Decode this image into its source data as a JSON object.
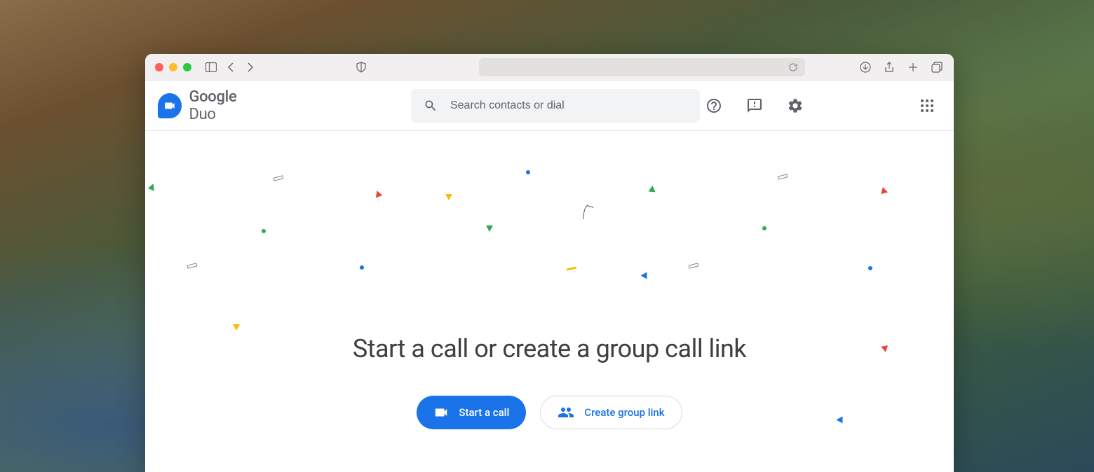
{
  "app": {
    "name_bold": "Google",
    "name_light": "Duo"
  },
  "search": {
    "placeholder": "Search contacts or dial"
  },
  "main": {
    "headline": "Start a call or create a group call link",
    "start_call_label": "Start a call",
    "create_group_label": "Create group link"
  },
  "colors": {
    "blue": "#1a73e8",
    "red": "#ea4335",
    "yellow": "#fbbc04",
    "green": "#34a853",
    "grey": "#5f6368"
  }
}
